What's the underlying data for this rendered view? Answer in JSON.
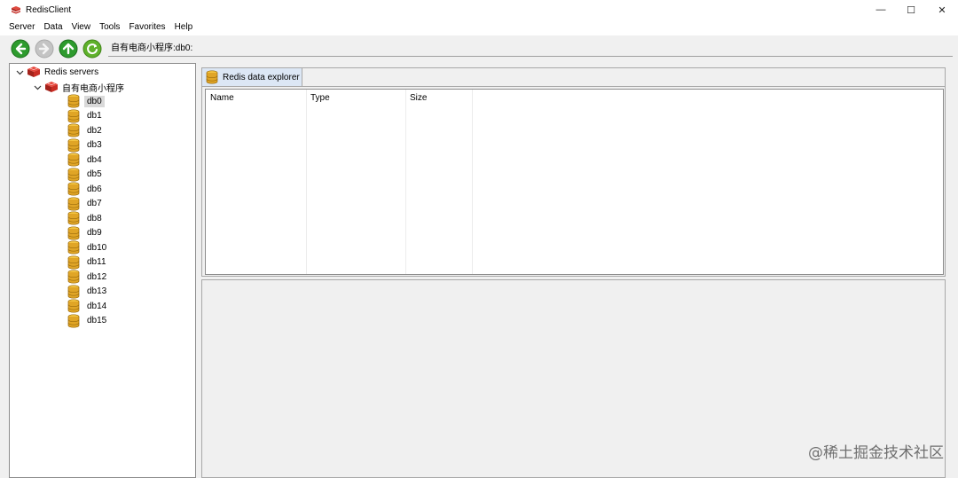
{
  "window": {
    "title": "RedisClient",
    "minimize_glyph": "—",
    "maximize_glyph": "☐",
    "close_glyph": "✕"
  },
  "menu": [
    "Server",
    "Data",
    "View",
    "Tools",
    "Favorites",
    "Help"
  ],
  "toolbar": {
    "buttons": [
      {
        "name": "back-icon",
        "color": "#2e9b2e",
        "enabled": true
      },
      {
        "name": "forward-icon",
        "color": "#b8b8b8",
        "enabled": false
      },
      {
        "name": "up-icon",
        "color": "#2e9b2e",
        "enabled": true
      },
      {
        "name": "refresh-icon",
        "color": "#5fb12b",
        "enabled": true
      }
    ],
    "path": "自有电商小程序:db0:"
  },
  "tree": {
    "root_label": "Redis servers",
    "server_label": "自有电商小程序",
    "databases": [
      "db0",
      "db1",
      "db2",
      "db3",
      "db4",
      "db5",
      "db6",
      "db7",
      "db8",
      "db9",
      "db10",
      "db11",
      "db12",
      "db13",
      "db14",
      "db15"
    ],
    "selected": "db0"
  },
  "explorer": {
    "tab_label": "Redis data explorer",
    "columns": [
      "Name",
      "Type",
      "Size"
    ]
  },
  "watermark": "@稀土掘金技术社区",
  "colors": {
    "redis_red": "#c9302c",
    "db_gold": "#e0a526",
    "selection": "#d9d9d9",
    "tab_active": "#dce7f5"
  }
}
